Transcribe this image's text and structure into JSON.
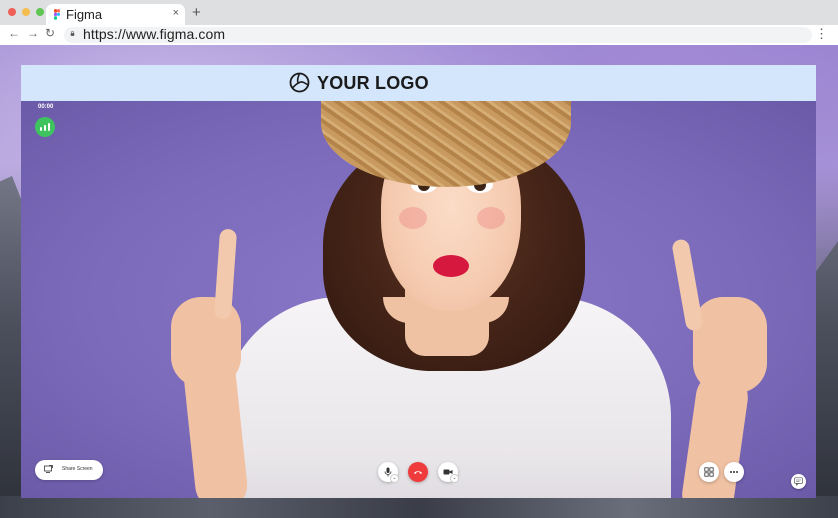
{
  "browser": {
    "tab_title": "Figma",
    "tab_close": "×",
    "new_tab": "+",
    "url": "https://www.figma.com",
    "back": "←",
    "forward": "→",
    "reload": "↻",
    "menu": "⋮",
    "traffic_lights": [
      "#ee5f57",
      "#f5bd4f",
      "#60c554"
    ]
  },
  "header": {
    "logo_text": "YOUR LOGO",
    "bg_color": "#d3e6fb"
  },
  "call": {
    "timer": "00:00",
    "signal_color": "#3fc35f",
    "share_label": "Share Screen",
    "end_color": "#ef3b3b"
  }
}
